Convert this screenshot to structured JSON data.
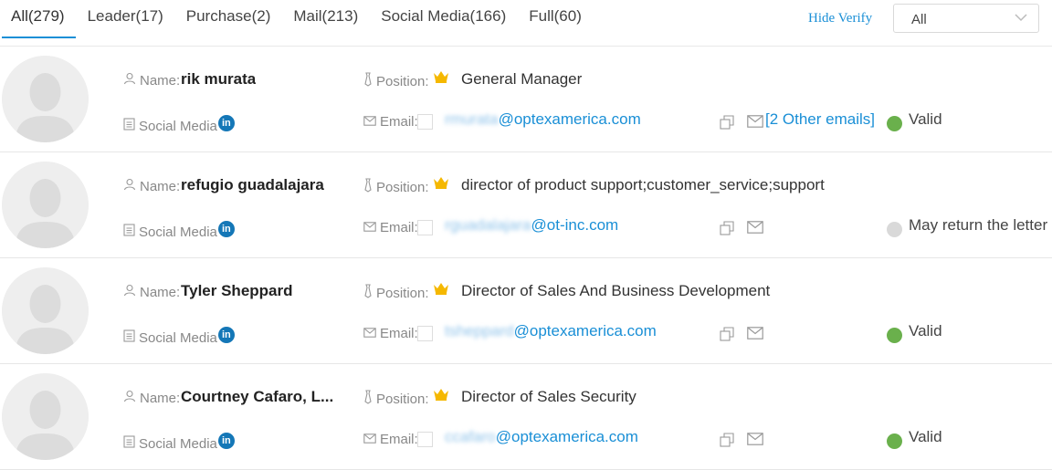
{
  "tabs": [
    {
      "label": "All(279)"
    },
    {
      "label": "Leader(17)"
    },
    {
      "label": "Purchase(2)"
    },
    {
      "label": "Mail(213)"
    },
    {
      "label": "Social Media(166)"
    },
    {
      "label": "Full(60)"
    }
  ],
  "active_tab": "All(279)",
  "hide_verify": "Hide Verify",
  "filter_select": {
    "value": "All"
  },
  "labels": {
    "name": "Name:",
    "position": "Position:",
    "email": "Email:",
    "social": "Social Media",
    "linkedin": "in"
  },
  "colors": {
    "accent": "#1a8fd6",
    "valid": "#6ab04c",
    "unknown": "#d9d9d9",
    "crown": "#f5b800",
    "linkedin": "#1477b7"
  },
  "contacts": [
    {
      "name": "rik murata",
      "position": "General Manager",
      "email_hidden": "rmurata",
      "email_domain": "@optexamerica.com",
      "other_emails": "[2 Other emails]",
      "status": "Valid",
      "status_color": "#6ab04c"
    },
    {
      "name": "refugio guadalajara",
      "position": "director of product support;customer_service;support",
      "email_hidden": "rguadalajara",
      "email_domain": "@ot-inc.com",
      "other_emails": "",
      "status": "May return the letter",
      "status_color": "#d9d9d9"
    },
    {
      "name": "Tyler Sheppard",
      "position": "Director of Sales And Business Development",
      "email_hidden": "tsheppard",
      "email_domain": "@optexamerica.com",
      "other_emails": "",
      "status": "Valid",
      "status_color": "#6ab04c"
    },
    {
      "name": "Courtney Cafaro, L...",
      "position": "Director of Sales Security",
      "email_hidden": "ccafaro",
      "email_domain": "@optexamerica.com",
      "other_emails": "",
      "status": "Valid",
      "status_color": "#6ab04c"
    }
  ]
}
